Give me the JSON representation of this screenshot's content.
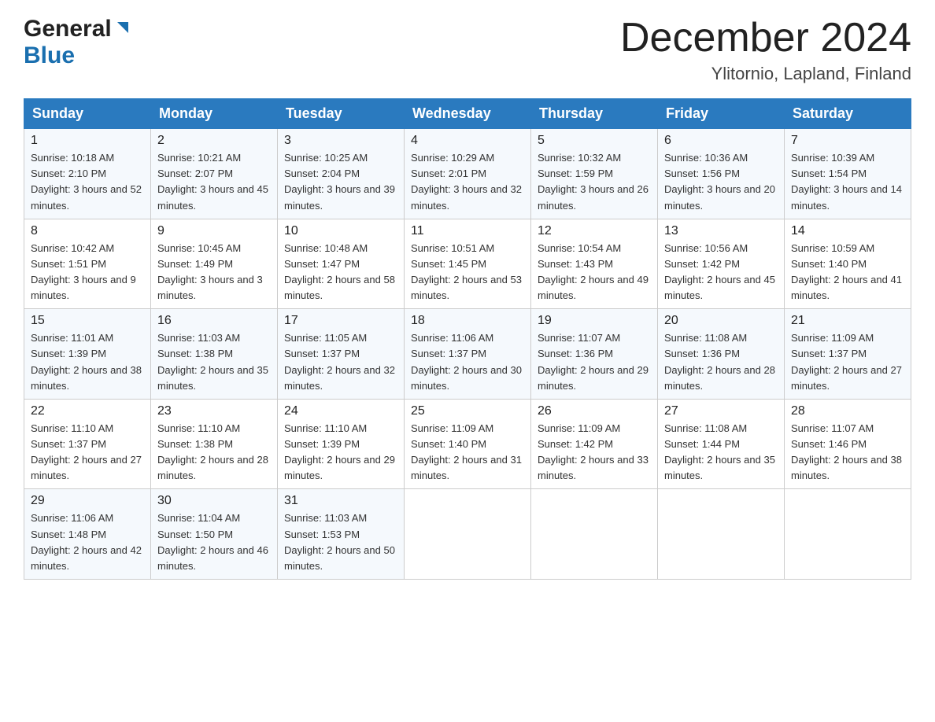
{
  "header": {
    "logo_general": "General",
    "logo_blue": "Blue",
    "month_title": "December 2024",
    "location": "Ylitornio, Lapland, Finland"
  },
  "weekdays": [
    "Sunday",
    "Monday",
    "Tuesday",
    "Wednesday",
    "Thursday",
    "Friday",
    "Saturday"
  ],
  "weeks": [
    [
      {
        "day": "1",
        "sunrise": "Sunrise: 10:18 AM",
        "sunset": "Sunset: 2:10 PM",
        "daylight": "Daylight: 3 hours and 52 minutes."
      },
      {
        "day": "2",
        "sunrise": "Sunrise: 10:21 AM",
        "sunset": "Sunset: 2:07 PM",
        "daylight": "Daylight: 3 hours and 45 minutes."
      },
      {
        "day": "3",
        "sunrise": "Sunrise: 10:25 AM",
        "sunset": "Sunset: 2:04 PM",
        "daylight": "Daylight: 3 hours and 39 minutes."
      },
      {
        "day": "4",
        "sunrise": "Sunrise: 10:29 AM",
        "sunset": "Sunset: 2:01 PM",
        "daylight": "Daylight: 3 hours and 32 minutes."
      },
      {
        "day": "5",
        "sunrise": "Sunrise: 10:32 AM",
        "sunset": "Sunset: 1:59 PM",
        "daylight": "Daylight: 3 hours and 26 minutes."
      },
      {
        "day": "6",
        "sunrise": "Sunrise: 10:36 AM",
        "sunset": "Sunset: 1:56 PM",
        "daylight": "Daylight: 3 hours and 20 minutes."
      },
      {
        "day": "7",
        "sunrise": "Sunrise: 10:39 AM",
        "sunset": "Sunset: 1:54 PM",
        "daylight": "Daylight: 3 hours and 14 minutes."
      }
    ],
    [
      {
        "day": "8",
        "sunrise": "Sunrise: 10:42 AM",
        "sunset": "Sunset: 1:51 PM",
        "daylight": "Daylight: 3 hours and 9 minutes."
      },
      {
        "day": "9",
        "sunrise": "Sunrise: 10:45 AM",
        "sunset": "Sunset: 1:49 PM",
        "daylight": "Daylight: 3 hours and 3 minutes."
      },
      {
        "day": "10",
        "sunrise": "Sunrise: 10:48 AM",
        "sunset": "Sunset: 1:47 PM",
        "daylight": "Daylight: 2 hours and 58 minutes."
      },
      {
        "day": "11",
        "sunrise": "Sunrise: 10:51 AM",
        "sunset": "Sunset: 1:45 PM",
        "daylight": "Daylight: 2 hours and 53 minutes."
      },
      {
        "day": "12",
        "sunrise": "Sunrise: 10:54 AM",
        "sunset": "Sunset: 1:43 PM",
        "daylight": "Daylight: 2 hours and 49 minutes."
      },
      {
        "day": "13",
        "sunrise": "Sunrise: 10:56 AM",
        "sunset": "Sunset: 1:42 PM",
        "daylight": "Daylight: 2 hours and 45 minutes."
      },
      {
        "day": "14",
        "sunrise": "Sunrise: 10:59 AM",
        "sunset": "Sunset: 1:40 PM",
        "daylight": "Daylight: 2 hours and 41 minutes."
      }
    ],
    [
      {
        "day": "15",
        "sunrise": "Sunrise: 11:01 AM",
        "sunset": "Sunset: 1:39 PM",
        "daylight": "Daylight: 2 hours and 38 minutes."
      },
      {
        "day": "16",
        "sunrise": "Sunrise: 11:03 AM",
        "sunset": "Sunset: 1:38 PM",
        "daylight": "Daylight: 2 hours and 35 minutes."
      },
      {
        "day": "17",
        "sunrise": "Sunrise: 11:05 AM",
        "sunset": "Sunset: 1:37 PM",
        "daylight": "Daylight: 2 hours and 32 minutes."
      },
      {
        "day": "18",
        "sunrise": "Sunrise: 11:06 AM",
        "sunset": "Sunset: 1:37 PM",
        "daylight": "Daylight: 2 hours and 30 minutes."
      },
      {
        "day": "19",
        "sunrise": "Sunrise: 11:07 AM",
        "sunset": "Sunset: 1:36 PM",
        "daylight": "Daylight: 2 hours and 29 minutes."
      },
      {
        "day": "20",
        "sunrise": "Sunrise: 11:08 AM",
        "sunset": "Sunset: 1:36 PM",
        "daylight": "Daylight: 2 hours and 28 minutes."
      },
      {
        "day": "21",
        "sunrise": "Sunrise: 11:09 AM",
        "sunset": "Sunset: 1:37 PM",
        "daylight": "Daylight: 2 hours and 27 minutes."
      }
    ],
    [
      {
        "day": "22",
        "sunrise": "Sunrise: 11:10 AM",
        "sunset": "Sunset: 1:37 PM",
        "daylight": "Daylight: 2 hours and 27 minutes."
      },
      {
        "day": "23",
        "sunrise": "Sunrise: 11:10 AM",
        "sunset": "Sunset: 1:38 PM",
        "daylight": "Daylight: 2 hours and 28 minutes."
      },
      {
        "day": "24",
        "sunrise": "Sunrise: 11:10 AM",
        "sunset": "Sunset: 1:39 PM",
        "daylight": "Daylight: 2 hours and 29 minutes."
      },
      {
        "day": "25",
        "sunrise": "Sunrise: 11:09 AM",
        "sunset": "Sunset: 1:40 PM",
        "daylight": "Daylight: 2 hours and 31 minutes."
      },
      {
        "day": "26",
        "sunrise": "Sunrise: 11:09 AM",
        "sunset": "Sunset: 1:42 PM",
        "daylight": "Daylight: 2 hours and 33 minutes."
      },
      {
        "day": "27",
        "sunrise": "Sunrise: 11:08 AM",
        "sunset": "Sunset: 1:44 PM",
        "daylight": "Daylight: 2 hours and 35 minutes."
      },
      {
        "day": "28",
        "sunrise": "Sunrise: 11:07 AM",
        "sunset": "Sunset: 1:46 PM",
        "daylight": "Daylight: 2 hours and 38 minutes."
      }
    ],
    [
      {
        "day": "29",
        "sunrise": "Sunrise: 11:06 AM",
        "sunset": "Sunset: 1:48 PM",
        "daylight": "Daylight: 2 hours and 42 minutes."
      },
      {
        "day": "30",
        "sunrise": "Sunrise: 11:04 AM",
        "sunset": "Sunset: 1:50 PM",
        "daylight": "Daylight: 2 hours and 46 minutes."
      },
      {
        "day": "31",
        "sunrise": "Sunrise: 11:03 AM",
        "sunset": "Sunset: 1:53 PM",
        "daylight": "Daylight: 2 hours and 50 minutes."
      },
      null,
      null,
      null,
      null
    ]
  ]
}
